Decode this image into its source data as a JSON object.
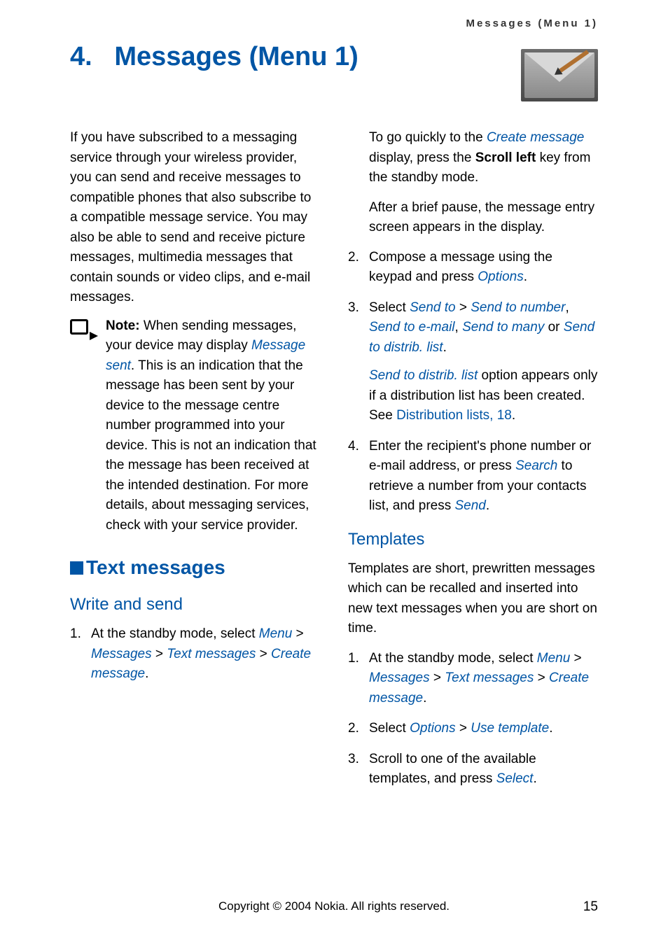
{
  "runningHeader": "Messages (Menu 1)",
  "chapterNumber": "4.",
  "chapterTitle": "Messages (Menu 1)",
  "introPara": "If you have subscribed to a messaging service through your wireless provider, you can send and receive messages to compatible phones that also subscribe to a compatible message service. You may also be able to send and receive picture messages, multimedia messages that contain sounds or video clips, and e-mail messages.",
  "note": {
    "label": "Note: ",
    "pre": "When sending messages, your device may display ",
    "msgSent": "Message sent",
    "post": ". This is an indication that the message has been sent by your device to the message centre number programmed into your device. This is not an indication that the message has been received at the intended destination. For more details, about messaging services, check with your service provider."
  },
  "textMessages": {
    "heading": "Text messages",
    "writeAndSend": {
      "heading": "Write and send",
      "step1": {
        "pre": "At the standby mode, select ",
        "menu": "Menu",
        "gt1": " > ",
        "messages": "Messages",
        "gt2": " > ",
        "textMsgs": "Text messages",
        "gt3": " > ",
        "createMsg": "Create message",
        "period": "."
      },
      "stepContA": {
        "pre": "To go quickly to the ",
        "createMsg": "Create message",
        "mid": " display, press the ",
        "scrollLeft": "Scroll left",
        "post": " key from the standby mode."
      },
      "stepContB": "After a brief pause, the message entry screen appears in the display.",
      "step2": {
        "pre": "Compose a message using the keypad and press ",
        "options": "Options",
        "period": "."
      },
      "step3": {
        "pre": "Select ",
        "sendTo": "Send to",
        "gt": " > ",
        "sendToNum": "Send to number",
        "comma1": ", ",
        "sendToEmail": "Send to e-mail",
        "comma2": ", ",
        "sendToMany": "Send to many",
        "or": " or ",
        "sendToDist": "Send to distrib. list",
        "period": "."
      },
      "step3Cont": {
        "sendToDist": "Send to distrib. list",
        "mid": " option appears only if a distribution list has been created. See ",
        "link": "Distribution lists, 18",
        "period": "."
      },
      "step4": {
        "pre": "Enter the recipient's phone number or e-mail address, or press ",
        "search": "Search",
        "mid": " to retrieve a number from your contacts list, and press ",
        "send": "Send",
        "period": "."
      }
    },
    "templates": {
      "heading": "Templates",
      "intro": "Templates are short, prewritten messages which can be recalled and inserted into new text messages when you are short on time.",
      "step1": {
        "pre": "At the standby mode, select ",
        "menu": "Menu",
        "gt1": " > ",
        "messages": "Messages",
        "gt2": " > ",
        "textMsgs": "Text messages",
        "gt3": " > ",
        "createMsg": "Create message",
        "period": "."
      },
      "step2": {
        "pre": "Select ",
        "options": "Options",
        "gt": " > ",
        "useTemplate": "Use template",
        "period": "."
      },
      "step3": {
        "pre": "Scroll to one of the available templates, and press ",
        "select": "Select",
        "period": "."
      }
    }
  },
  "footer": {
    "copyright": "Copyright © 2004 Nokia. All rights reserved.",
    "pageNum": "15"
  }
}
